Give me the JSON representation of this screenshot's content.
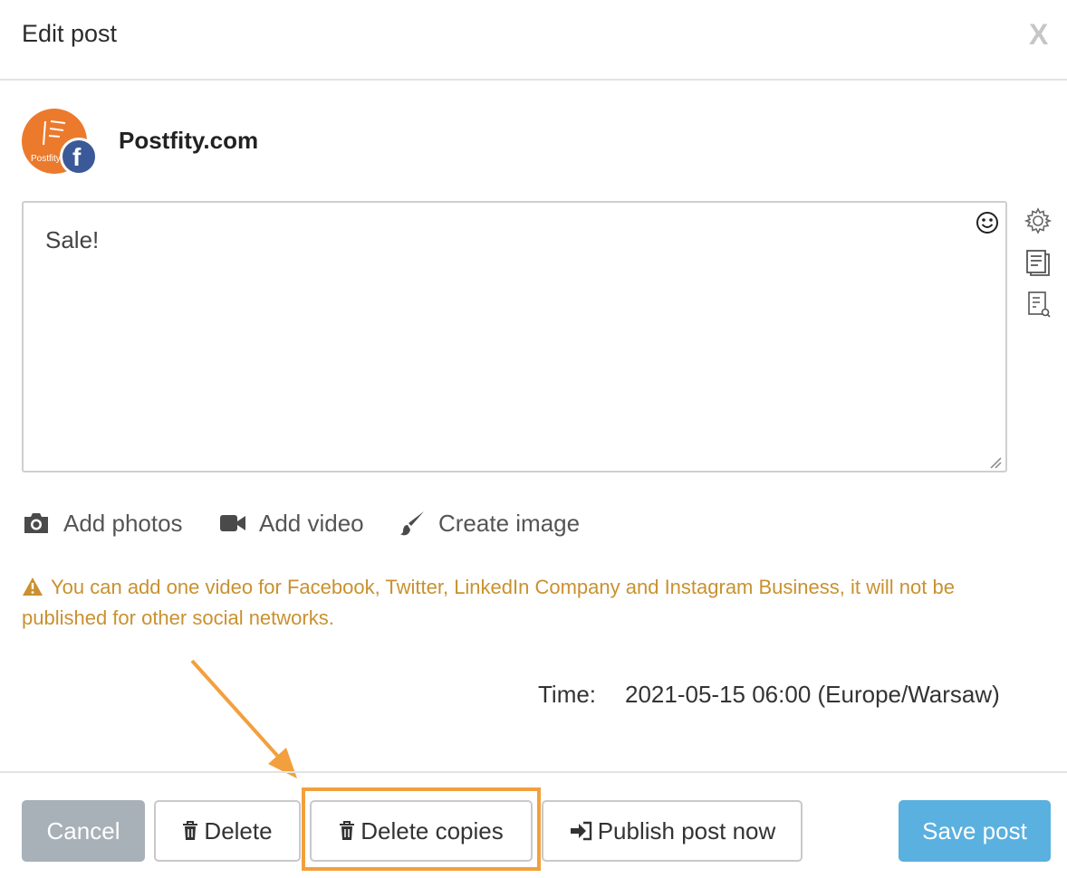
{
  "dialog": {
    "title": "Edit post",
    "close_label": "X"
  },
  "account": {
    "name": "Postfity.com",
    "avatar_brand": "Postfity",
    "network": "facebook",
    "network_icon": "facebook-icon",
    "brand_color": "#ec7a2c",
    "network_color": "#3b5998"
  },
  "editor": {
    "text": "Sale!",
    "icons": [
      "emoji-icon",
      "resize-grip-icon"
    ]
  },
  "side_tools": [
    "settings-gear-icon",
    "notes-document-icon",
    "preview-document-icon"
  ],
  "media": {
    "add_photos": "Add photos",
    "add_video": "Add video",
    "create_image": "Create image"
  },
  "warning": {
    "text": "You can add one video for Facebook, Twitter, LinkedIn Company and Instagram Business, it will not be published for other social networks.",
    "color": "#c9912f"
  },
  "schedule": {
    "label": "Time:",
    "value": "2021-05-15 06:00 (Europe/Warsaw)"
  },
  "buttons": {
    "cancel": "Cancel",
    "delete": "Delete",
    "delete_copies": "Delete copies",
    "publish_now": "Publish post now",
    "save": "Save post"
  },
  "colors": {
    "cancel_bg": "#a8b0b8",
    "save_bg": "#5ab0df",
    "highlight": "#f2a03d"
  }
}
